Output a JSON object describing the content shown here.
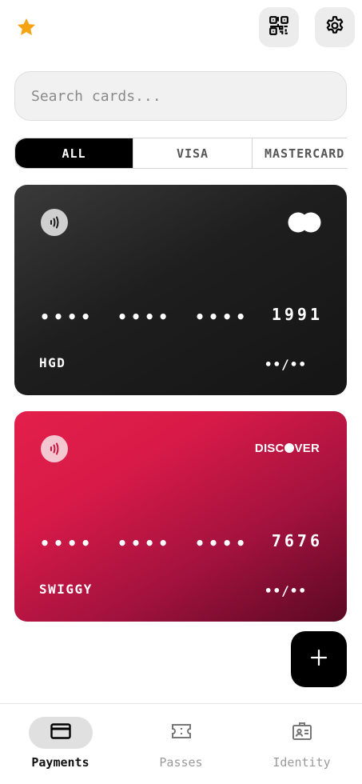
{
  "header": {
    "favorite_icon": "star-icon",
    "scan_icon": "qr-code-icon",
    "settings_icon": "gear-icon",
    "star_color": "#f6a313"
  },
  "search": {
    "placeholder": "Search cards..."
  },
  "filters": [
    {
      "label": "ALL",
      "active": true
    },
    {
      "label": "VISA",
      "active": false
    },
    {
      "label": "MASTERCARD",
      "active": false
    }
  ],
  "cards": [
    {
      "network": "mastercard",
      "masked_groups": [
        "••••",
        "••••",
        "••••"
      ],
      "last4": "1991",
      "holder": "HGD",
      "expiry": "••/••",
      "gradient_start": "#3a3a3a",
      "gradient_end": "#151515"
    },
    {
      "network": "discover",
      "network_logo_text_1": "DISC",
      "network_logo_text_2": "VER",
      "masked_groups": [
        "••••",
        "••••",
        "••••"
      ],
      "last4": "7676",
      "holder": "SWIGGY",
      "expiry": "••/••",
      "gradient_start": "#e31f4a",
      "gradient_end": "#5a0923"
    }
  ],
  "fab": {
    "icon": "plus-icon"
  },
  "bottom_nav": [
    {
      "label": "Payments",
      "icon": "credit-card-icon",
      "active": true
    },
    {
      "label": "Passes",
      "icon": "ticket-icon",
      "active": false
    },
    {
      "label": "Identity",
      "icon": "id-badge-icon",
      "active": false
    }
  ]
}
